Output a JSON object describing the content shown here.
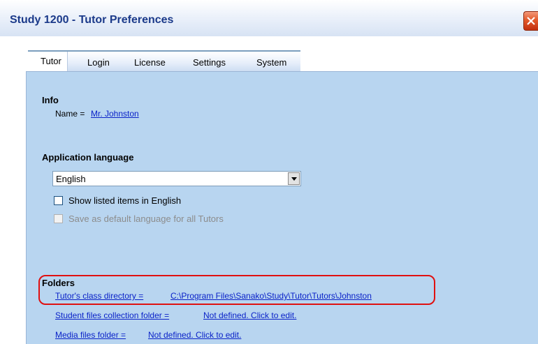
{
  "window": {
    "title": "Study 1200 - Tutor Preferences",
    "close_icon": "close-x-icon"
  },
  "tabs": [
    "Tutor",
    "Login",
    "License",
    "Settings",
    "System"
  ],
  "active_tab": "Tutor",
  "info": {
    "heading": "Info",
    "name_label": "Name =",
    "name_value": "Mr. Johnston"
  },
  "language": {
    "heading": "Application language",
    "selected": "English",
    "show_english_label": "Show listed items in English",
    "show_english_checked": false,
    "save_default_label": "Save as default language for all Tutors",
    "save_default_checked": false,
    "save_default_enabled": false
  },
  "folders": {
    "heading": "Folders",
    "class_dir_label": "Tutor's class directory =",
    "class_dir_value": "C:\\Program Files\\Sanako\\Study\\Tutor\\Tutors\\Johnston",
    "student_files_label": "Student files collection folder =",
    "student_files_value": "Not defined. Click to edit.",
    "media_files_label": "Media files folder =",
    "media_files_value": "Not defined. Click to edit."
  },
  "colors": {
    "panel_bg": "#b8d5f0",
    "link": "#0a22c8",
    "highlight": "#e01010",
    "title_text": "#1b3a8a"
  }
}
